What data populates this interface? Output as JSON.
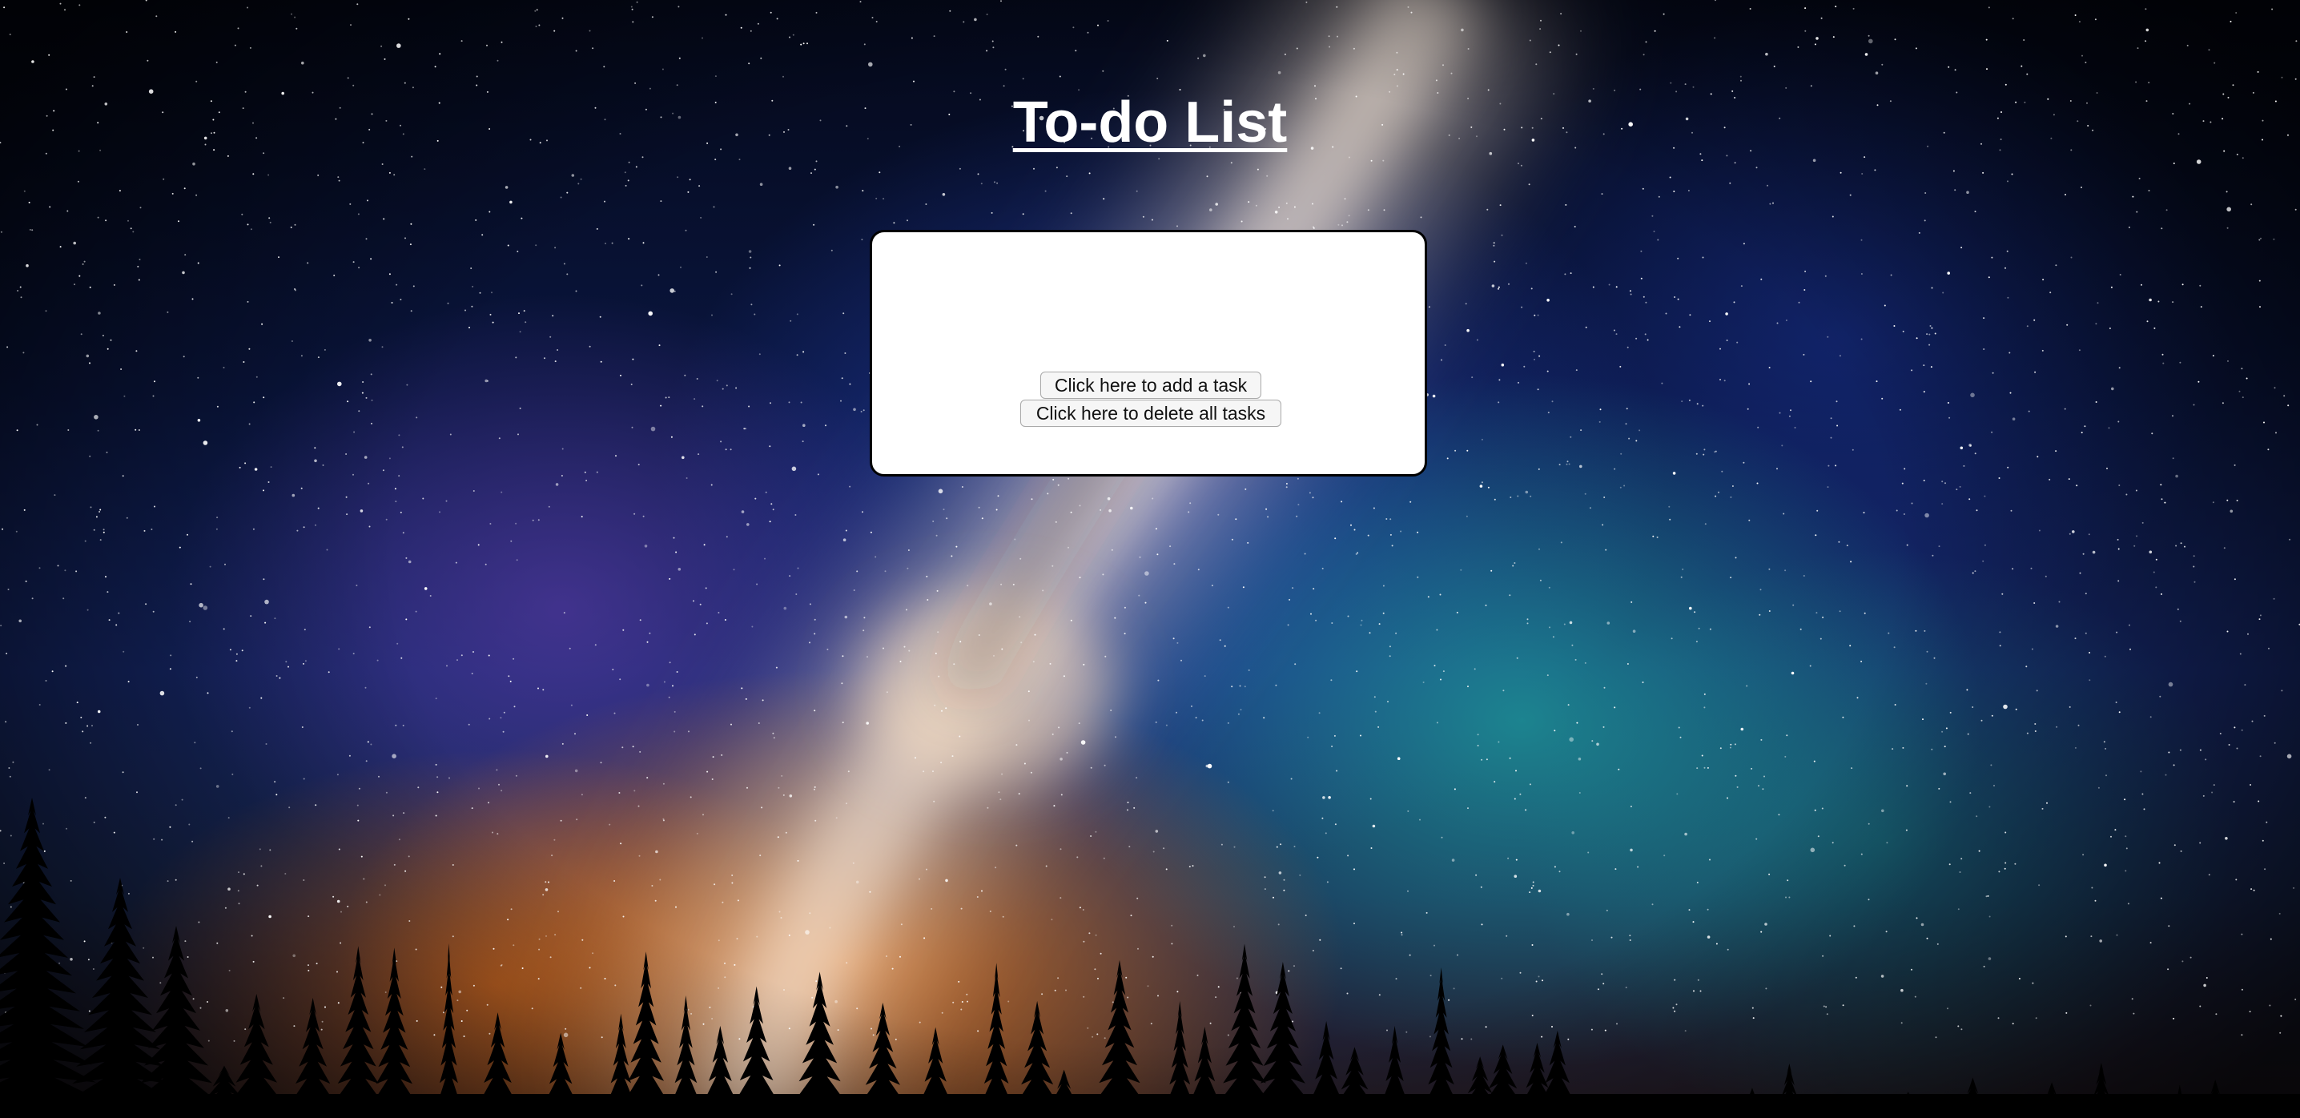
{
  "page": {
    "title": "To-do List"
  },
  "todo": {
    "tasks": [],
    "add_button_label": "Click here to add a task",
    "delete_all_button_label": "Click here to delete all tasks"
  },
  "background": {
    "description_icon": "starry-night-sky-image"
  },
  "colors": {
    "title_text": "#ffffff",
    "card_background": "#ffffff",
    "card_border": "#000000"
  }
}
